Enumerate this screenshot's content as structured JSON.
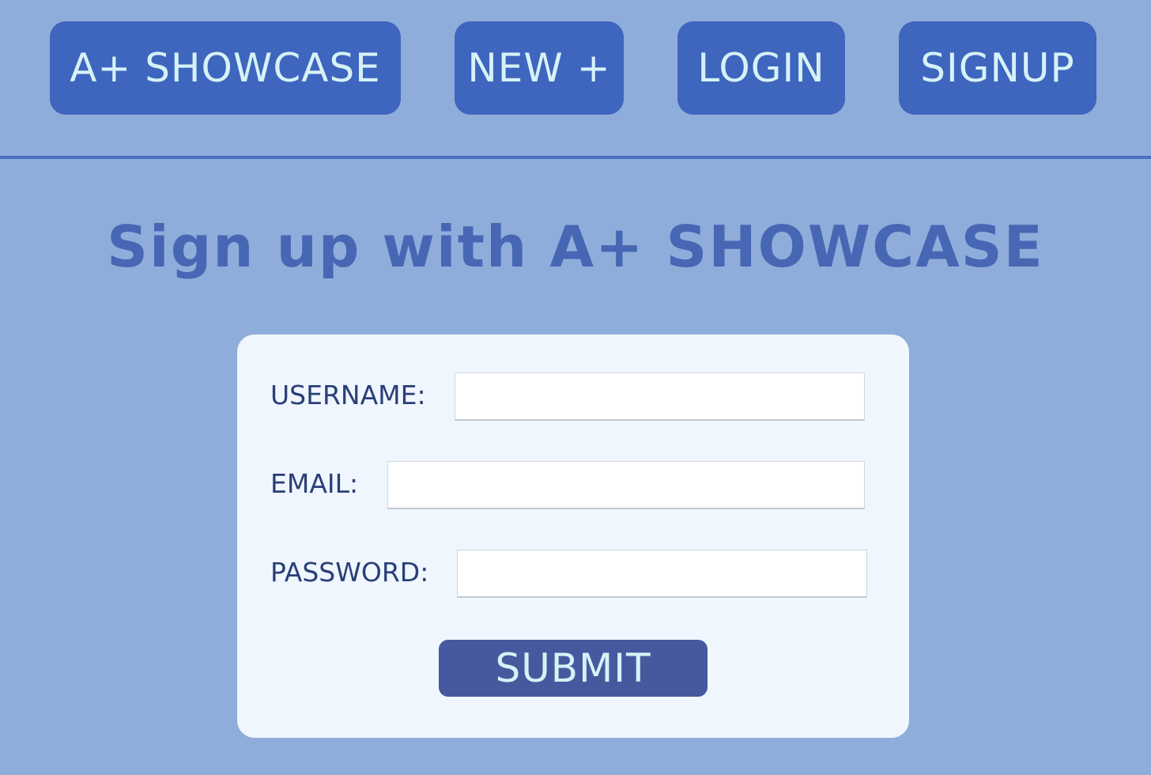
{
  "nav": {
    "home_label": "A+ SHOWCASE",
    "new_label": "NEW +",
    "login_label": "LOGIN",
    "signup_label": "SIGNUP"
  },
  "page": {
    "title": "Sign up with A+ SHOWCASE"
  },
  "form": {
    "username_label": "USERNAME:",
    "username_value": "",
    "email_label": "EMAIL:",
    "email_value": "",
    "password_label": "PASSWORD:",
    "password_value": "",
    "submit_label": "SUBMIT"
  },
  "colors": {
    "background": "#8fadda",
    "nav_button": "#3e66be",
    "nav_text": "#d6f2f7",
    "title_text": "#4766b4",
    "card": "#eff6fd",
    "submit_button": "#47599e"
  }
}
